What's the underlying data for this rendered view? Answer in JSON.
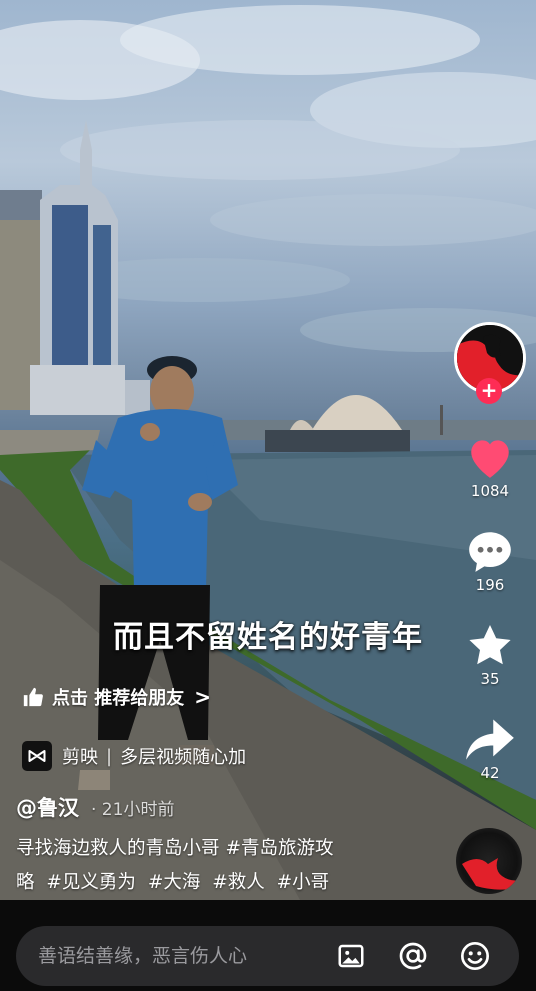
{
  "video": {
    "subtitle": "而且不留姓名的好青年"
  },
  "recommend": {
    "label": "点击 推荐给朋友",
    "chevron": ">"
  },
  "capcut": {
    "app": "剪映",
    "separator": "|",
    "slogan": "多层视频随心加"
  },
  "author": {
    "name": "@鲁汉",
    "time": "· 21小时前"
  },
  "description": {
    "lines": [
      [
        "寻找海边救人的青岛小哥",
        "#青岛旅游攻"
      ],
      [
        "略",
        "#见义勇为",
        "#大海",
        "#救人",
        "#小哥"
      ]
    ]
  },
  "side": {
    "follow": "+",
    "likes": "1084",
    "comments": "196",
    "favorites": "35",
    "shares": "42",
    "like_color": "#ff4b73"
  },
  "progress": {
    "fraction": 0.73
  },
  "comment_bar": {
    "placeholder": "善语结善缘，恶言伤人心"
  },
  "icons": [
    "thumb-up-icon",
    "capcut-logo-icon",
    "heart-icon",
    "comment-icon",
    "star-icon",
    "share-icon",
    "image-icon",
    "at-icon",
    "emoji-icon"
  ]
}
